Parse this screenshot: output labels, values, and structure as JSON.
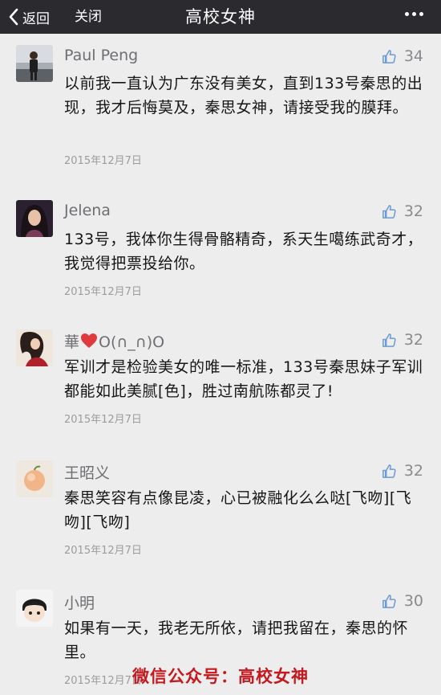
{
  "header": {
    "back_label": "返回",
    "close_label": "关闭",
    "title": "高校女神",
    "icons": {
      "back": "chevron-left-icon",
      "more": "more-dots-icon"
    }
  },
  "comments": [
    {
      "name": "Paul Peng",
      "likes": "34",
      "text": "以前我一直认为广东没有美女，直到133号秦思的出现，我才后悔莫及，秦思女神，请接受我的膜拜。",
      "date": "2015年12月7日"
    },
    {
      "name": "Jelena",
      "likes": "32",
      "text": "133号，我体你生得骨骼精奇，系天生噶练武奇才，我觉得把票投给你。",
      "date": "2015年12月7日"
    },
    {
      "name_text": "華",
      "name_suffix": "O(∩_∩)O",
      "likes": "32",
      "text": "军训才是检验美女的唯一标准，133号秦思妹子军训都能如此美腻[色]，胜过南航陈都灵了!",
      "date": "2015年12月7日"
    },
    {
      "name": "王昭义",
      "likes": "32",
      "text": "秦思笑容有点像昆凌，心已被融化么么哒[飞吻][飞吻][飞吻]",
      "date": "2015年12月7日"
    },
    {
      "name": "小明",
      "likes": "30",
      "text": "如果有一天，我老无所依，请把我留在，秦思的怀里。",
      "date": "2015年12月7日"
    }
  ],
  "watermark": "微信公众号：高校女神",
  "colors": {
    "topbar": "#2b2b2f",
    "background": "#ededed",
    "watermark": "#c4191f",
    "heart": "#e0393e"
  }
}
